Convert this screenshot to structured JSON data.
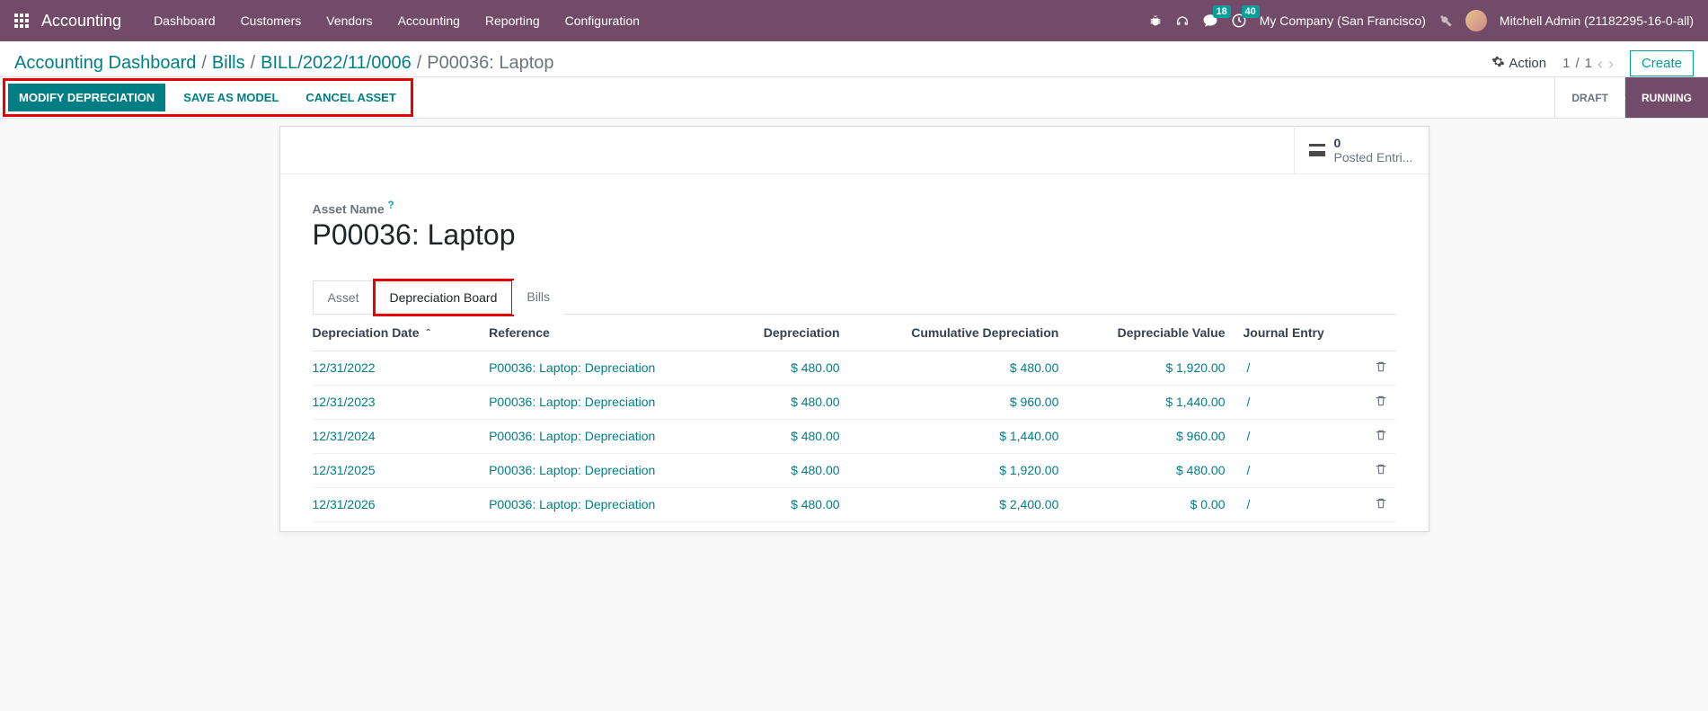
{
  "navbar": {
    "brand": "Accounting",
    "menus": [
      "Dashboard",
      "Customers",
      "Vendors",
      "Accounting",
      "Reporting",
      "Configuration"
    ],
    "messages_badge": "18",
    "activities_badge": "40",
    "company": "My Company (San Francisco)",
    "user": "Mitchell Admin (21182295-16-0-all)"
  },
  "breadcrumb": {
    "items": [
      "Accounting Dashboard",
      "Bills",
      "BILL/2022/11/0006"
    ],
    "current": "P00036: Laptop"
  },
  "controls": {
    "action_label": "Action",
    "page_current": "1",
    "page_total": "1",
    "create_label": "Create"
  },
  "actions": {
    "modify": "MODIFY DEPRECIATION",
    "save_model": "SAVE AS MODEL",
    "cancel_asset": "CANCEL ASSET"
  },
  "status": {
    "draft": "DRAFT",
    "running": "RUNNING"
  },
  "smart": {
    "posted_count": "0",
    "posted_label": "Posted Entri..."
  },
  "asset": {
    "label": "Asset Name",
    "help_mark": "?",
    "name": "P00036: Laptop"
  },
  "tabs": {
    "asset": "Asset",
    "dep_board": "Depreciation Board",
    "bills": "Bills"
  },
  "table": {
    "headers": {
      "date": "Depreciation Date",
      "reference": "Reference",
      "depreciation": "Depreciation",
      "cumulative": "Cumulative Depreciation",
      "depreciable": "Depreciable Value",
      "journal_entry": "Journal Entry"
    },
    "rows": [
      {
        "date": "12/31/2022",
        "reference": "P00036: Laptop: Depreciation",
        "depreciation": "$ 480.00",
        "cumulative": "$ 480.00",
        "depreciable": "$ 1,920.00",
        "journal_entry": "/"
      },
      {
        "date": "12/31/2023",
        "reference": "P00036: Laptop: Depreciation",
        "depreciation": "$ 480.00",
        "cumulative": "$ 960.00",
        "depreciable": "$ 1,440.00",
        "journal_entry": "/"
      },
      {
        "date": "12/31/2024",
        "reference": "P00036: Laptop: Depreciation",
        "depreciation": "$ 480.00",
        "cumulative": "$ 1,440.00",
        "depreciable": "$ 960.00",
        "journal_entry": "/"
      },
      {
        "date": "12/31/2025",
        "reference": "P00036: Laptop: Depreciation",
        "depreciation": "$ 480.00",
        "cumulative": "$ 1,920.00",
        "depreciable": "$ 480.00",
        "journal_entry": "/"
      },
      {
        "date": "12/31/2026",
        "reference": "P00036: Laptop: Depreciation",
        "depreciation": "$ 480.00",
        "cumulative": "$ 2,400.00",
        "depreciable": "$ 0.00",
        "journal_entry": "/"
      }
    ]
  }
}
